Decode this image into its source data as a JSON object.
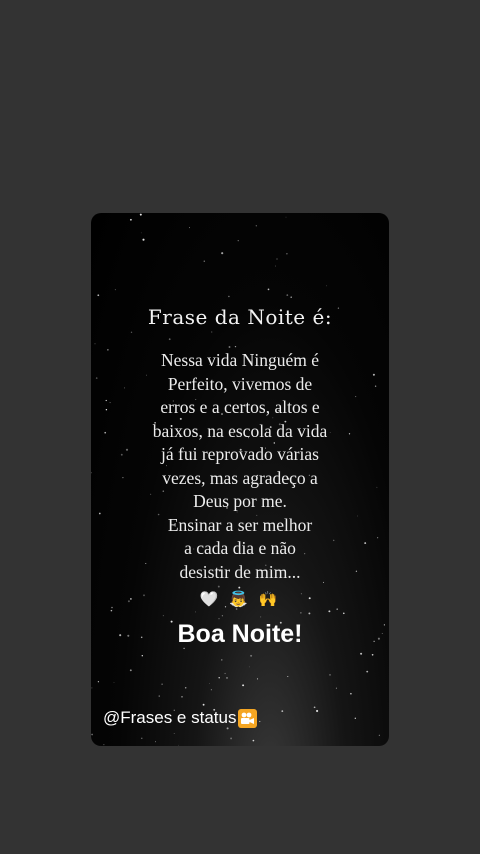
{
  "story": {
    "title": "Frase da Noite é:",
    "lines": [
      "Nessa vida Ninguém é",
      "Perfeito, vivemos de",
      "erros e a certos, altos e",
      "baixos, na escola da vida",
      "já fui reprovado várias",
      "vezes, mas agradeço a",
      "Deus por me.",
      "Ensinar a ser melhor",
      "a cada dia e não",
      "desistir de mim..."
    ],
    "emojis": "🤍 👼 🙌",
    "closing": "Boa Noite!",
    "handle": "@Frases e status",
    "handle_icon": "movie-camera-icon"
  },
  "colors": {
    "page_background": "#333333",
    "card_background": "#000000",
    "handle_icon_background": "#f5a623"
  }
}
